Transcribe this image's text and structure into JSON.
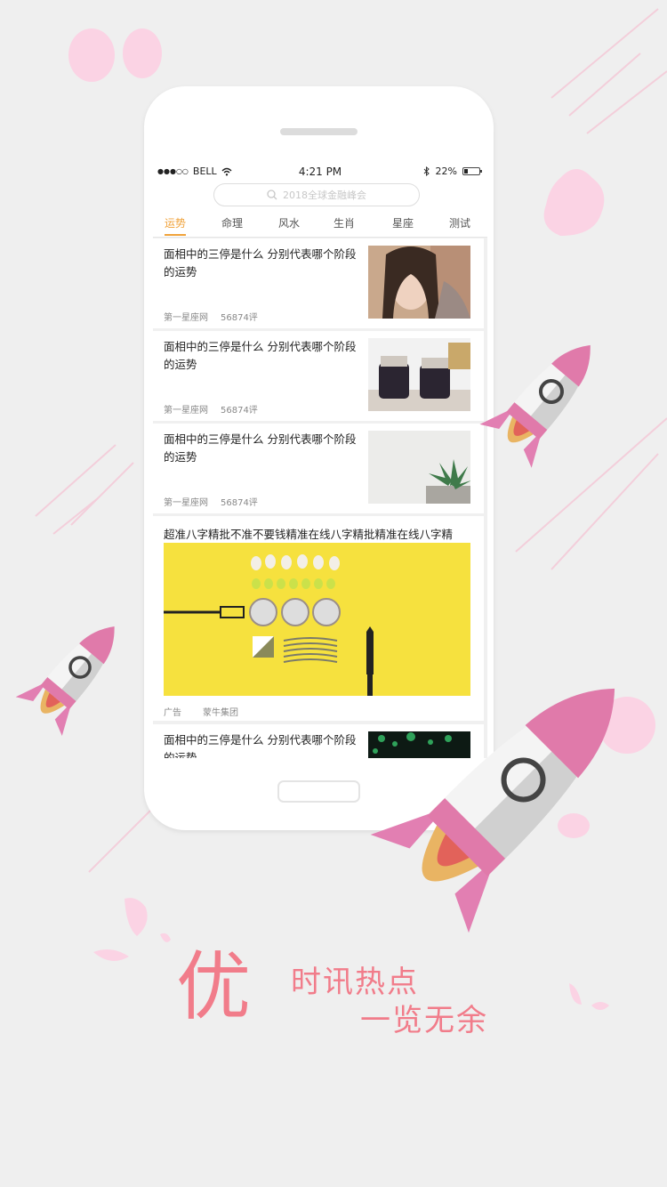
{
  "status_bar": {
    "signal": "●●●○○",
    "carrier": "BELL",
    "time": "4:21 PM",
    "battery_pct": "22%"
  },
  "search": {
    "placeholder": "2018全球金融峰会"
  },
  "tabs": [
    {
      "label": "运势",
      "active": true
    },
    {
      "label": "命理"
    },
    {
      "label": "风水"
    },
    {
      "label": "生肖"
    },
    {
      "label": "星座"
    },
    {
      "label": "测试"
    }
  ],
  "articles": [
    {
      "title": "面相中的三停是什么 分别代表哪个阶段的运势",
      "source": "第一星座网",
      "comments": "56874评"
    },
    {
      "title": "面相中的三停是什么 分别代表哪个阶段的运势",
      "source": "第一星座网",
      "comments": "56874评"
    },
    {
      "title": "面相中的三停是什么 分别代表哪个阶段的运势",
      "source": "第一星座网",
      "comments": "56874评"
    },
    {
      "title": "面相中的三停是什么 分别代表哪个阶段的运势"
    }
  ],
  "ad": {
    "title": "超准八字精批不准不要钱精准在线八字精批精准在线八字精",
    "label": "广告",
    "sponsor": "蒙牛集团"
  },
  "tagline": {
    "big": "优",
    "line1": "时讯热点",
    "line2": "一览无余"
  },
  "colors": {
    "accent": "#f0a23a",
    "pink": "#f17c8a",
    "rocket_pink": "#e07aaa"
  }
}
